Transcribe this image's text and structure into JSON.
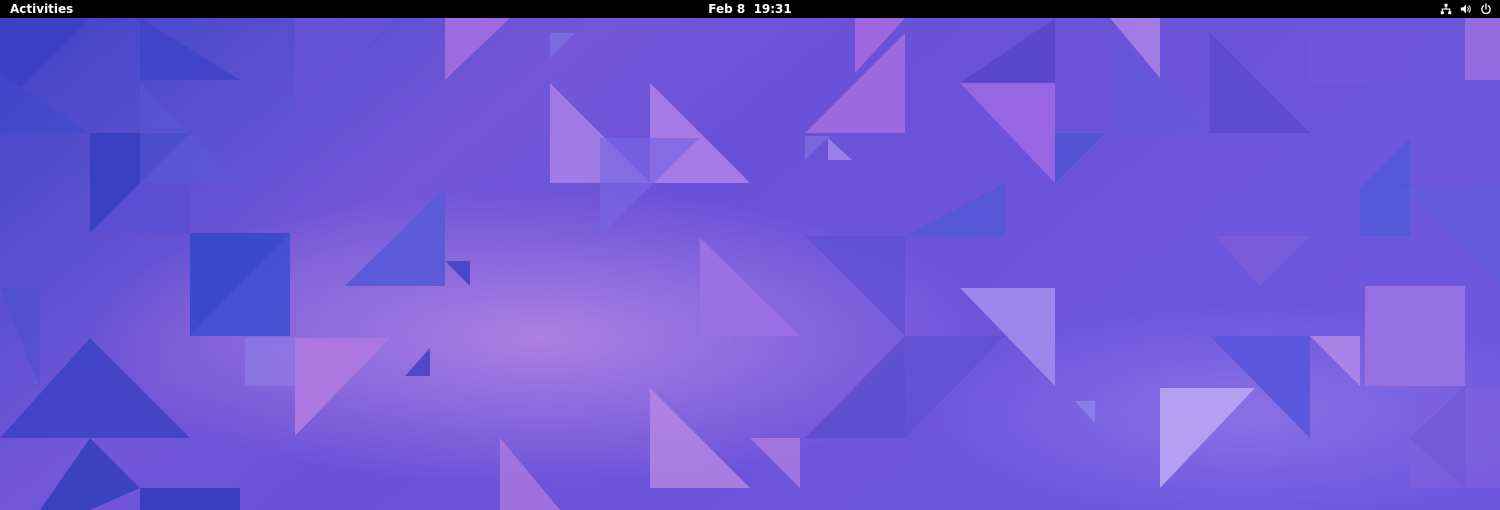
{
  "topbar": {
    "activities_label": "Activities",
    "date": "Feb 8",
    "time": "19:31",
    "status_icons": [
      "network-wired-icon",
      "volume-icon",
      "power-icon"
    ]
  },
  "desktop": {
    "wallpaper_colors": {
      "base": "#5a4fd6",
      "deep_blue": "#3b47c9",
      "violet": "#7a5fe0",
      "pink": "#b884e6",
      "light": "#a58bee"
    }
  }
}
